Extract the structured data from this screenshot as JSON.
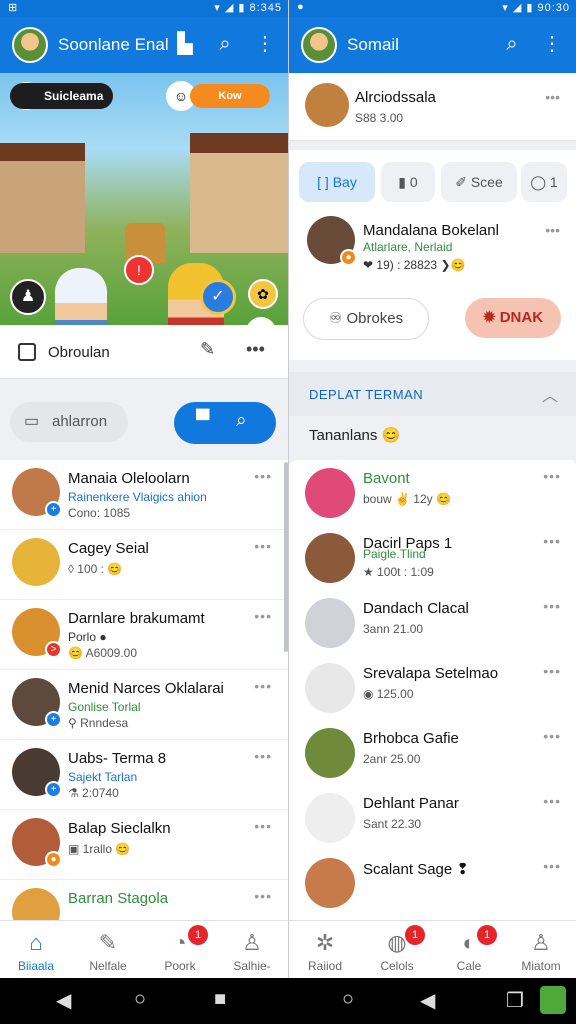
{
  "status_left": {
    "time": "8:345",
    "left_icons": "⊞"
  },
  "status_right": {
    "time": "90:30"
  },
  "left": {
    "app_title": "Soonlane Enal",
    "game": {
      "player_name": "Suicleama",
      "coin_label": "Kow"
    },
    "game_bar_label": "Obroulan",
    "search_chip": "ahlarron",
    "list": [
      {
        "name": "Manaia Oleloolarn",
        "sub": "Rainenkere Vlaigics ahion",
        "meta": "Cono: 1085",
        "sub_color": "#1a6fd0",
        "badge_color": "#1a7fe0",
        "badge": "+",
        "avatar_bg": "#c07a4a"
      },
      {
        "name": "Cagey Seial",
        "sub": "",
        "meta": "◊ 100 : 😊",
        "sub_color": "#1a6fd0",
        "badge_color": "#1a7fe0",
        "badge": "",
        "avatar_bg": "#e7b43a"
      },
      {
        "name": "Darnlare brakumamt",
        "sub": "Porlo ●",
        "meta": "😊 A6009.00",
        "sub_color": "#333",
        "badge_color": "#e03a2e",
        "badge": ">",
        "avatar_bg": "#d9902e"
      },
      {
        "name": "Menid Narces Oklalarai",
        "sub": "Gonlise Torlal",
        "meta": "⚲ Rnndesa",
        "sub_color": "#2f8f3a",
        "badge_color": "#1a7fe0",
        "badge": "+",
        "avatar_bg": "#5d4a3c"
      },
      {
        "name": "Uabs- Terma 8",
        "sub": "Sajekt Tarlan",
        "meta": "⚗ 2:0740",
        "sub_color": "#1a6fd0",
        "badge_color": "#1a7fe0",
        "badge": "+",
        "avatar_bg": "#4a3b32"
      },
      {
        "name": "Balap Sieclalkn",
        "sub": "",
        "meta": "▣ 1rallo 😊",
        "sub_color": "#333",
        "badge_color": "#f08a1c",
        "badge": "●",
        "avatar_bg": "#b25d3a"
      },
      {
        "name": "Barran Stagola",
        "sub": "",
        "meta": "",
        "sub_color": "#333",
        "badge_color": "#1a7fe0",
        "badge": "",
        "avatar_bg": "#e0a040",
        "name_color": "#2f8f3a"
      }
    ],
    "nav": [
      {
        "label": "Biiaala",
        "icon": "⌂",
        "badge": ""
      },
      {
        "label": "Nelfale",
        "icon": "✎",
        "badge": ""
      },
      {
        "label": "Poork",
        "icon": "◔",
        "badge": "1"
      },
      {
        "label": "Salhie-",
        "icon": "♙",
        "badge": ""
      }
    ]
  },
  "right": {
    "app_title": "Somail",
    "profile": {
      "name": "Alrciodssala",
      "meta": "S88 3.00"
    },
    "tabs": [
      {
        "label": "Bay",
        "icon": "[ ]"
      },
      {
        "label": "0",
        "icon": "▮"
      },
      {
        "label": "Scee",
        "icon": "✐"
      },
      {
        "label": "1",
        "icon": "◯"
      }
    ],
    "post": {
      "name": "Mandalana Bokelanl",
      "sub": "Atlarlare, Nerlaid",
      "meta": "❤ 19) : 28823 ❯😊"
    },
    "btn_outline": "Obrokes",
    "btn_outline_icon": "♾",
    "btn_dnak": "DNAK",
    "section_title": "DEPLAT TERMAN",
    "section_sub": "Tananlans 😊",
    "list": [
      {
        "name": "Bavont",
        "meta": "bouw  ✌  12y 😊",
        "sub": "",
        "name_color": "#2f8f3a",
        "avatar_bg": "#e04a78"
      },
      {
        "name": "Dacirl Paps 1",
        "sub": "Paigle.Tlind",
        "meta": "★ 100t : 1:09",
        "name_color": "#111",
        "avatar_bg": "#8a5a3a"
      },
      {
        "name": "Dandach Clacal",
        "sub": "",
        "meta": "3ann 21.00",
        "name_color": "#111",
        "avatar_bg": "#cfd2d6"
      },
      {
        "name": "Srevalapa Setelmao",
        "sub": "",
        "meta": "◉ 125.00",
        "name_color": "#111",
        "avatar_bg": "#e8e8e8"
      },
      {
        "name": "Brhobca Gafie",
        "sub": "",
        "meta": "2anr 25.00",
        "name_color": "#111",
        "avatar_bg": "#6e8a3a"
      },
      {
        "name": "Dehlant Panar",
        "sub": "",
        "meta": "Sant 22.30",
        "name_color": "#111",
        "avatar_bg": "#eeeeee"
      },
      {
        "name": "Scalant Sage ❢",
        "sub": "",
        "meta": "",
        "name_color": "#111",
        "avatar_bg": "#c77a4a"
      }
    ],
    "nav": [
      {
        "label": "Raiiod",
        "icon": "✲",
        "badge": ""
      },
      {
        "label": "Celols",
        "icon": "◍",
        "badge": "1"
      },
      {
        "label": "Cale",
        "icon": "◐",
        "badge": "1"
      },
      {
        "label": "Miatom",
        "icon": "♙",
        "badge": ""
      }
    ]
  },
  "colors": {
    "primary": "#1178dd",
    "badge_red": "#e4262b",
    "dnak_bg": "#f6c3b2"
  }
}
